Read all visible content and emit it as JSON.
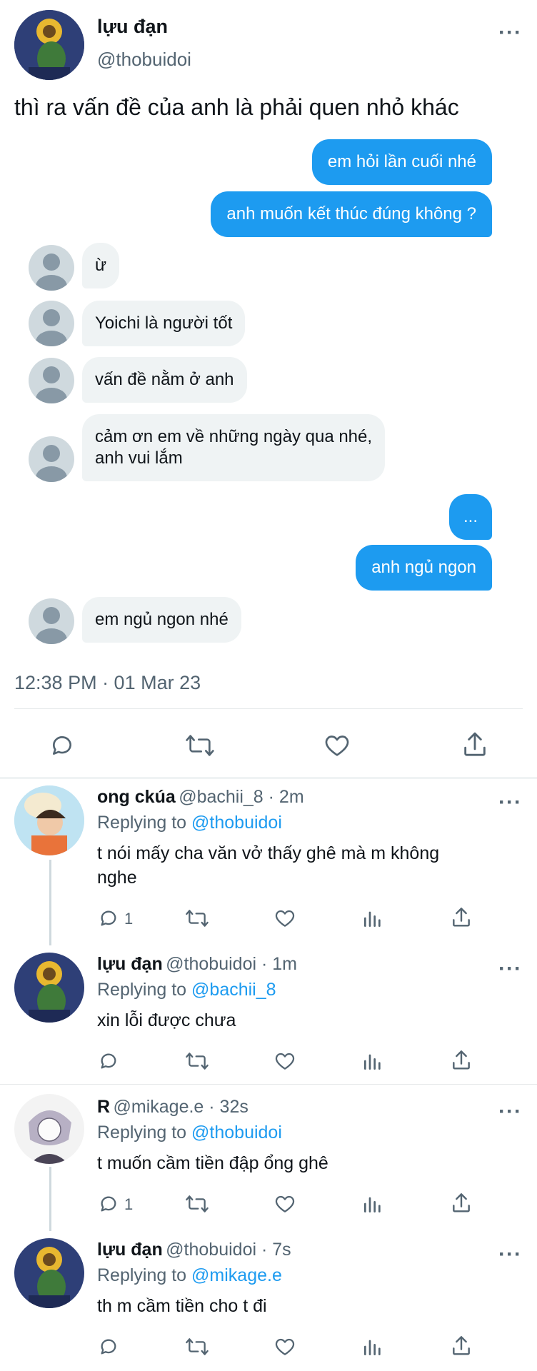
{
  "main_tweet": {
    "display_name": "lựu đạn",
    "handle": "@thobuidoi",
    "text": "thì ra vấn đề của anh là phải quen nhỏ khác",
    "timestamp": "12:38 PM · 01 Mar 23"
  },
  "chat": {
    "outgoing_1": "em hỏi lần cuối nhé",
    "outgoing_2": "anh muốn kết thúc đúng không ?",
    "incoming_1": "ừ",
    "incoming_2": "Yoichi là người tốt",
    "incoming_3": "vấn đề nằm ở anh",
    "incoming_4_line1": "cảm ơn em về những ngày qua nhé,",
    "incoming_4_line2": "anh vui lắm",
    "outgoing_3": "...",
    "outgoing_4": "anh ngủ ngon",
    "incoming_5": "em ngủ ngon nhé"
  },
  "replies": [
    {
      "display_name": "ong ckúa",
      "handle": "@bachii_8 · 2m",
      "replying_prefix": "Replying to ",
      "replying_to": "@thobuidoi",
      "text_line1": "t nói mấy cha văn vở thấy ghê mà m không",
      "text_line2": "nghe",
      "reply_count": "1"
    },
    {
      "display_name": "lựu đạn",
      "handle": "@thobuidoi · 1m",
      "replying_prefix": "Replying to ",
      "replying_to": "@bachii_8",
      "text_line1": "xin lỗi được chưa",
      "reply_count": ""
    },
    {
      "display_name": "R",
      "handle": "@mikage.e · 32s",
      "replying_prefix": "Replying to ",
      "replying_to": "@thobuidoi",
      "text_line1": "t muốn cầm tiền đập ổng ghê",
      "reply_count": "1"
    },
    {
      "display_name": "lựu đạn",
      "handle": "@thobuidoi · 7s",
      "replying_prefix": "Replying to ",
      "replying_to": "@mikage.e",
      "text_line1": "th m cầm tiền cho t đi",
      "reply_count": ""
    }
  ],
  "colors": {
    "accent": "#1d9bf0",
    "bubble_in": "#eff3f4",
    "text_gray": "#536471"
  },
  "icons": [
    "more-icon",
    "reply-icon",
    "retweet-icon",
    "like-icon",
    "share-icon",
    "analytics-icon",
    "person-icon"
  ]
}
